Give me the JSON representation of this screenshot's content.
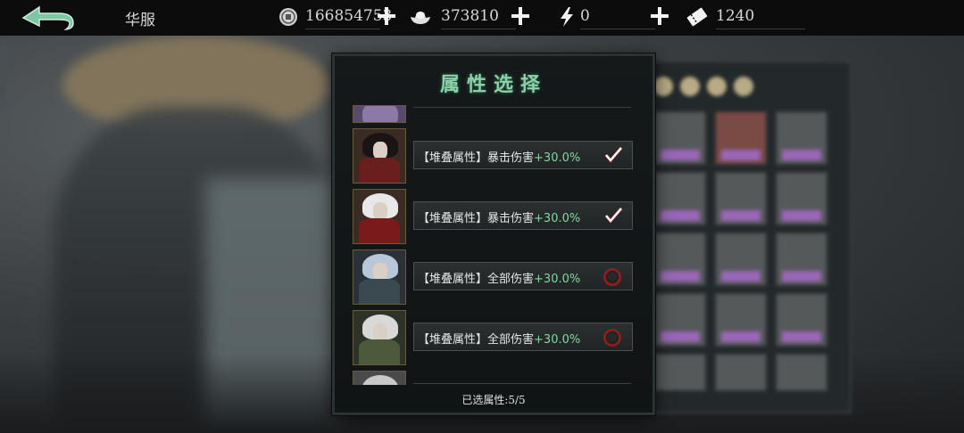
{
  "header": {
    "title": "华服",
    "resources": [
      {
        "icon": "coin-icon",
        "value": "166854753"
      },
      {
        "icon": "silver-ingot-icon",
        "value": "373810"
      },
      {
        "icon": "lightning-icon",
        "value": "0"
      },
      {
        "icon": "ticket-icon",
        "value": "1240"
      }
    ]
  },
  "panel": {
    "title": "属性选择",
    "selected_label": "已选属性:5/5",
    "rows": [
      {
        "prefix": "【堆叠属性】",
        "attr": "暴击伤害",
        "bonus": "+30.0%",
        "selected": true
      },
      {
        "prefix": "【堆叠属性】",
        "attr": "暴击伤害",
        "bonus": "+30.0%",
        "selected": true
      },
      {
        "prefix": "【堆叠属性】",
        "attr": "全部伤害",
        "bonus": "+30.0%",
        "selected": false
      },
      {
        "prefix": "【堆叠属性】",
        "attr": "全部伤害",
        "bonus": "+30.0%",
        "selected": false
      }
    ]
  },
  "colors": {
    "bonus_green": "#7fd9a0",
    "title_green": "#8ad0a8",
    "check_white": "#ffffff",
    "unselected_ring": "#8a1f1f"
  }
}
